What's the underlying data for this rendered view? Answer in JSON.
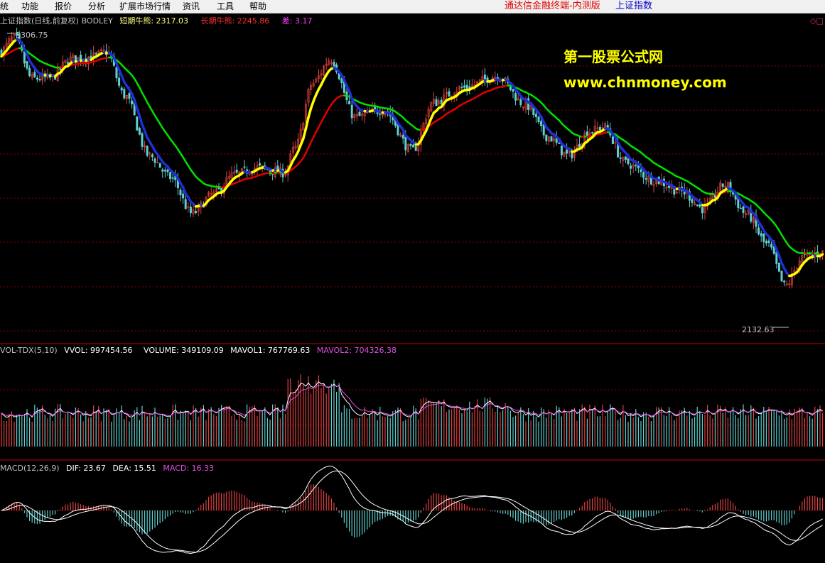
{
  "menu": {
    "items": [
      "统",
      "功能",
      "报价",
      "分析",
      "扩展市场行情",
      "资讯",
      "工具",
      "帮助"
    ],
    "brand": "通达信金融终端-内测版",
    "index_name": "上证指数"
  },
  "main_panel": {
    "title": "上证指数(日线,前复权) BODLEY",
    "short_label": "短期牛熊: 2317.03",
    "long_label": "长期牛熊: 2245.86",
    "diff_label": "差: 3.17",
    "high_label": "3306.75",
    "low_label": "2132.63",
    "corner_icon": "◇□"
  },
  "vol_panel": {
    "title": "VOL-TDX(5,10)",
    "vvol": "VVOL: 997454.56",
    "volume": "VOLUME: 349109.09",
    "mavol1": "MAVOL1: 767769.63",
    "mavol2": "MAVOL2: 704326.38"
  },
  "macd_panel": {
    "title": "MACD(12,26,9)",
    "dif": "DIF: 23.67",
    "dea": "DEA: 15.51",
    "macd": "MACD: 16.33"
  },
  "watermark": {
    "line1": "第一股票公式网",
    "line2": "www.chnmoney.com"
  },
  "colors": {
    "up": "#e04040",
    "down": "#60d0d0",
    "short_line_up": "#ffff00",
    "short_line_down": "#2030d0",
    "long_line_up": "#e00000",
    "long_line_down": "#00e000",
    "grid": "#8b0000"
  },
  "chart_data": {
    "type": "line",
    "price_range": [
      2132.63,
      3306.75
    ],
    "anchors_x": [
      0,
      20,
      45,
      70,
      100,
      130,
      150,
      175,
      210,
      240,
      270,
      300,
      330,
      360,
      400,
      415,
      440,
      465,
      500,
      540,
      580,
      610,
      650,
      700,
      740,
      770,
      800,
      830,
      850,
      880,
      920,
      960,
      990,
      1020,
      1050,
      1080,
      1105,
      1130,
      1161
    ],
    "anchors_price": [
      3230,
      3290,
      3120,
      3120,
      3200,
      3210,
      3230,
      3050,
      2800,
      2710,
      2560,
      2640,
      2720,
      2750,
      2730,
      2830,
      3100,
      3200,
      2960,
      2990,
      2820,
      3020,
      3080,
      3130,
      3010,
      2880,
      2800,
      2900,
      2920,
      2770,
      2700,
      2650,
      2580,
      2680,
      2560,
      2430,
      2260,
      2380,
      2400
    ]
  }
}
